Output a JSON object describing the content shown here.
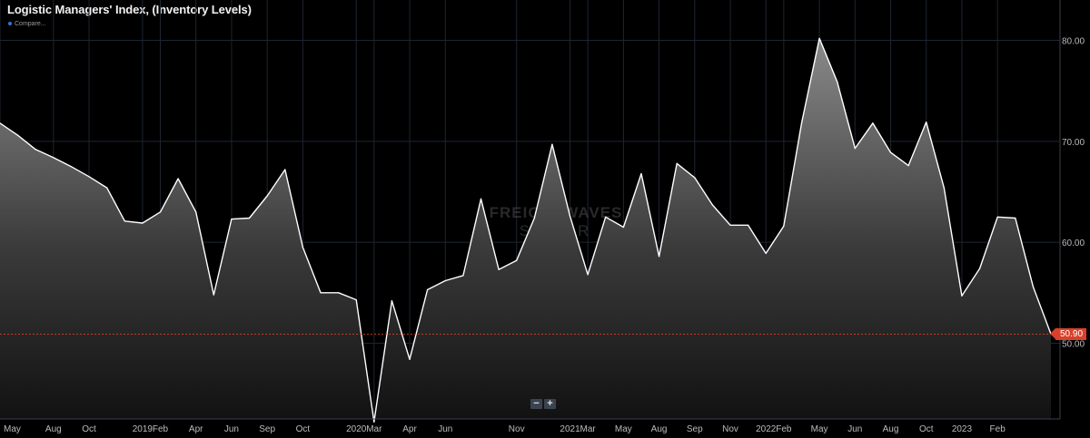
{
  "header": {
    "title": "Logistic Managers' Index, (Inventory Levels)",
    "compare_label": "Compare..."
  },
  "watermark": {
    "line1": "FREIGHTWAVES",
    "line2": "SONAR"
  },
  "zoom": {
    "minus": "−",
    "plus": "+"
  },
  "colors": {
    "accent": "#d9402a",
    "line": "#ffffff",
    "grid": "#1e2530",
    "compare_dot": "#3b6fd6"
  },
  "chart_data": {
    "type": "area",
    "title": "Logistic Managers' Index, (Inventory Levels)",
    "ylim": [
      42.5,
      84
    ],
    "y_ticks": [
      "80.00",
      "70.00",
      "60.00",
      "50.00"
    ],
    "y_tick_values": [
      80,
      70,
      60,
      50
    ],
    "x_ticks": [
      {
        "label": "May",
        "index": 0
      },
      {
        "label": "Aug",
        "index": 3
      },
      {
        "label": "Oct",
        "index": 5
      },
      {
        "label": "2019",
        "index": 8
      },
      {
        "label": "Feb",
        "index": 9
      },
      {
        "label": "Apr",
        "index": 11
      },
      {
        "label": "Jun",
        "index": 13
      },
      {
        "label": "Sep",
        "index": 15
      },
      {
        "label": "Oct",
        "index": 17
      },
      {
        "label": "2020",
        "index": 20
      },
      {
        "label": "Mar",
        "index": 21
      },
      {
        "label": "Apr",
        "index": 23
      },
      {
        "label": "Jun",
        "index": 25
      },
      {
        "label": "Nov",
        "index": 29
      },
      {
        "label": "2021",
        "index": 32
      },
      {
        "label": "Mar",
        "index": 33
      },
      {
        "label": "May",
        "index": 35
      },
      {
        "label": "Aug",
        "index": 37
      },
      {
        "label": "Sep",
        "index": 39
      },
      {
        "label": "Nov",
        "index": 41
      },
      {
        "label": "2022",
        "index": 43
      },
      {
        "label": "Feb",
        "index": 44
      },
      {
        "label": "May",
        "index": 46
      },
      {
        "label": "Jun",
        "index": 48
      },
      {
        "label": "Aug",
        "index": 50
      },
      {
        "label": "Oct",
        "index": 52
      },
      {
        "label": "2023",
        "index": 54
      },
      {
        "label": "Feb",
        "index": 56
      }
    ],
    "series": [
      {
        "values": [
          71.8,
          70.6,
          69.2,
          68.4,
          67.5,
          66.5,
          65.4,
          62.1,
          61.9,
          63.0,
          66.3,
          63.0,
          54.8,
          62.3,
          62.4,
          64.6,
          67.2,
          59.5,
          55.0,
          55.0,
          54.3,
          42.2,
          54.2,
          48.4,
          55.3,
          56.2,
          56.7,
          64.3,
          57.3,
          58.2,
          62.4,
          69.7,
          62.6,
          56.8,
          62.5,
          61.5,
          66.8,
          58.6,
          67.8,
          66.4,
          63.7,
          61.7,
          61.7,
          58.9,
          61.6,
          71.8,
          80.2,
          75.9,
          69.3,
          71.8,
          68.9,
          67.6,
          71.9,
          65.4,
          54.7,
          57.4,
          62.5,
          62.4,
          55.6,
          50.9
        ]
      }
    ],
    "last_value_label": "50.90",
    "last_value": 50.9,
    "grid": true
  }
}
